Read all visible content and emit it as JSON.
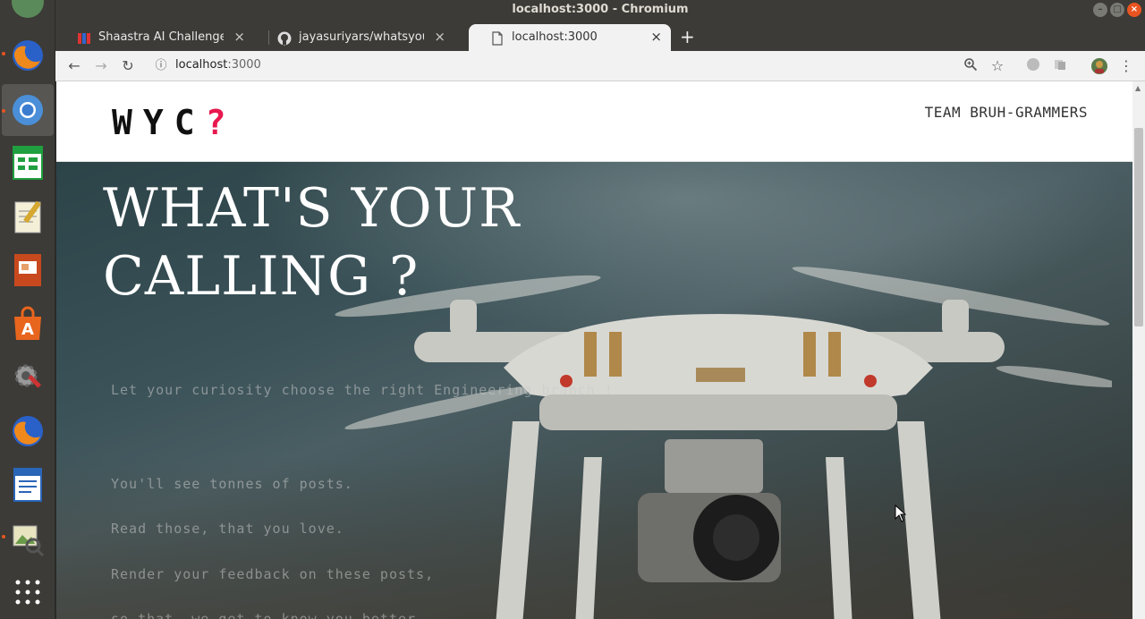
{
  "window": {
    "title": "localhost:3000 - Chromium"
  },
  "tabs": [
    {
      "label": "Shaastra AI Challenge, Sh",
      "icon": "shaastra-favicon-icon"
    },
    {
      "label": "jayasuriyars/whatsyourca",
      "icon": "github-icon"
    },
    {
      "label": "localhost:3000",
      "icon": "page-icon"
    }
  ],
  "toolbar": {
    "url_host": "localhost",
    "url_port": ":3000"
  },
  "site": {
    "logo_letters": "WYC",
    "logo_mark": "?",
    "team": "TEAM BRUH-GRAMMERS",
    "hero_title_line1": "WHAT'S YOUR",
    "hero_title_line2": "CALLING ?",
    "tagline": "Let your curiosity choose the right Engineering branch !",
    "lines": [
      "You'll see tonnes of posts.",
      "Read those, that you love.",
      "Render your feedback on these posts,",
      "so that, we get to know you better."
    ]
  },
  "colors": {
    "accent": "#e8184f",
    "ubuntu_orange": "#e95420"
  }
}
